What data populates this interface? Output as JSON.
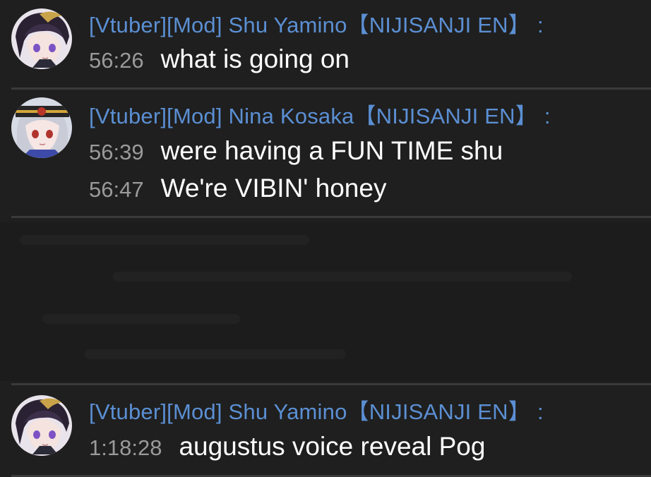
{
  "colors": {
    "background": "#1f1f1f",
    "author_name": "#5b8fd3",
    "timestamp": "#9a9a9a",
    "message_text": "#ffffff",
    "divider": "#3a3a3a"
  },
  "messages": [
    {
      "author": "[Vtuber][Mod] Shu Yamino【NIJISANJI EN】",
      "colon": ":",
      "avatar_icon": "shu-yamino-avatar-icon",
      "lines": [
        {
          "time": "56:26",
          "text": "what is going on"
        }
      ]
    },
    {
      "author": "[Vtuber][Mod] Nina Kosaka【NIJISANJI EN】",
      "colon": ":",
      "avatar_icon": "nina-kosaka-avatar-icon",
      "lines": [
        {
          "time": "56:39",
          "text": "were having a FUN TIME shu"
        },
        {
          "time": "56:47",
          "text": "We're VIBIN' honey"
        }
      ]
    },
    {
      "author": "[Vtuber][Mod] Shu Yamino【NIJISANJI EN】",
      "colon": ":",
      "avatar_icon": "shu-yamino-avatar-icon",
      "lines": [
        {
          "time": "1:18:28",
          "text": "augustus voice reveal Pog"
        }
      ]
    }
  ]
}
